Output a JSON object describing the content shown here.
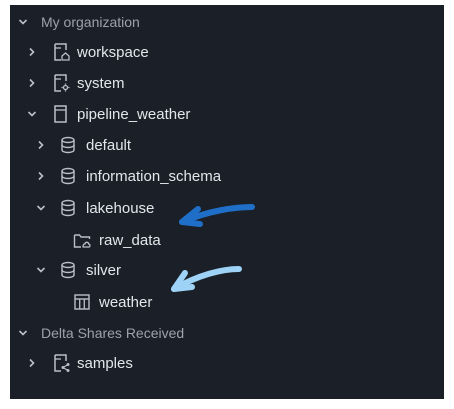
{
  "tree": {
    "sections": {
      "my_org": {
        "label": "My organization",
        "expanded": true
      },
      "delta": {
        "label": "Delta Shares Received",
        "expanded": true
      }
    },
    "items": {
      "workspace": {
        "label": "workspace",
        "icon": "catalog-home-icon",
        "expanded": false
      },
      "system": {
        "label": "system",
        "icon": "catalog-system-icon",
        "expanded": false
      },
      "pipeline_weather": {
        "label": "pipeline_weather",
        "icon": "catalog-icon",
        "expanded": true
      },
      "default": {
        "label": "default",
        "icon": "database-icon",
        "expanded": false
      },
      "information_schema": {
        "label": "information_schema",
        "icon": "database-icon",
        "expanded": false
      },
      "lakehouse": {
        "label": "lakehouse",
        "icon": "database-icon",
        "expanded": true
      },
      "raw_data": {
        "label": "raw_data",
        "icon": "volume-folder-icon"
      },
      "silver": {
        "label": "silver",
        "icon": "database-icon",
        "expanded": true
      },
      "weather": {
        "label": "weather",
        "icon": "table-icon"
      },
      "samples": {
        "label": "samples",
        "icon": "catalog-shared-icon",
        "expanded": false
      }
    }
  },
  "colors": {
    "panel_bg": "#1b1f27",
    "text": "#e3e6ea",
    "section_text": "#9aa3ad",
    "icon": "#b9c0c8",
    "arrow_dark": "#1f6fc9",
    "arrow_light": "#9fd2f7"
  }
}
